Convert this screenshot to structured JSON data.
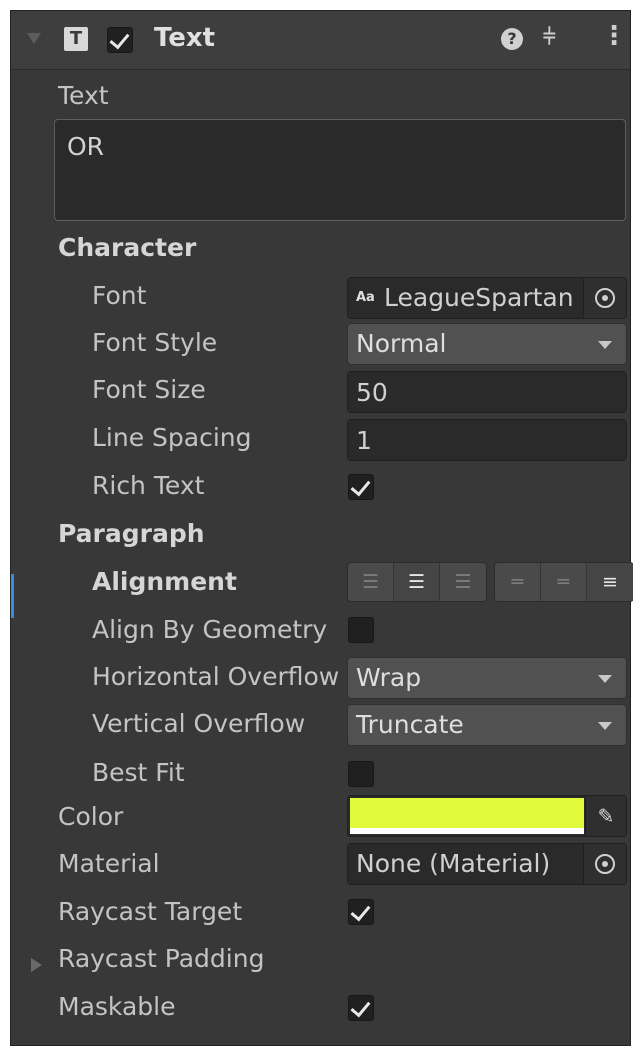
{
  "header": {
    "component_title": "Text",
    "enabled": true,
    "component_icon_letter": "T"
  },
  "text": {
    "label": "Text",
    "value": "OR"
  },
  "character": {
    "section_label": "Character",
    "font": {
      "label": "Font",
      "value": "LeagueSpartan",
      "icon_text": "Aa"
    },
    "font_style": {
      "label": "Font Style",
      "value": "Normal"
    },
    "font_size": {
      "label": "Font Size",
      "value": "50"
    },
    "line_spacing": {
      "label": "Line Spacing",
      "value": "1"
    },
    "rich_text": {
      "label": "Rich Text",
      "checked": true
    }
  },
  "paragraph": {
    "section_label": "Paragraph",
    "alignment": {
      "label": "Alignment",
      "horizontal_selected": "center",
      "vertical_selected": "bottom"
    },
    "align_by_geometry": {
      "label": "Align By Geometry",
      "checked": false
    },
    "horizontal_overflow": {
      "label": "Horizontal Overflow",
      "value": "Wrap"
    },
    "vertical_overflow": {
      "label": "Vertical Overflow",
      "value": "Truncate"
    },
    "best_fit": {
      "label": "Best Fit",
      "checked": false
    }
  },
  "color": {
    "label": "Color",
    "value": "#e1fb3c"
  },
  "material": {
    "label": "Material",
    "value": "None (Material)"
  },
  "raycast_target": {
    "label": "Raycast Target",
    "checked": true
  },
  "raycast_padding": {
    "label": "Raycast Padding"
  },
  "maskable": {
    "label": "Maskable",
    "checked": true
  }
}
